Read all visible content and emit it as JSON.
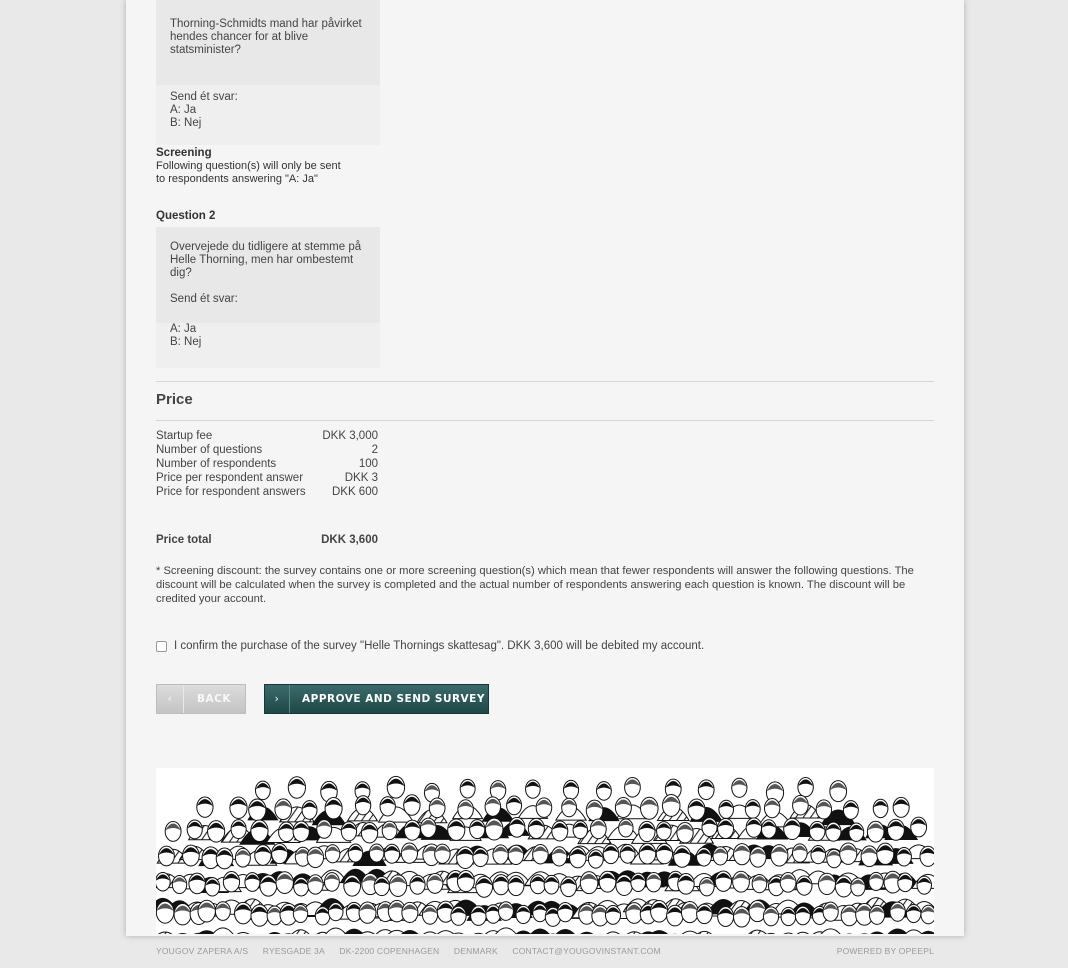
{
  "question1": {
    "text_lines": [
      "Thorning-Schmidts mand har påvirket",
      "hendes chancer for at blive",
      "statsminister?"
    ],
    "send_label": "Send ét svar:",
    "options": [
      "A: Ja",
      "B: Nej"
    ]
  },
  "screening": {
    "title": "Screening",
    "line1": "Following question(s) will only be sent",
    "line2": "to respondents answering \"A: Ja\""
  },
  "question2": {
    "label": "Question 2",
    "text_lines": [
      "Overvejede du tidligere at stemme på",
      "Helle Thorning, men har ombestemt",
      "dig?"
    ],
    "send_label": "Send ét svar:",
    "options": [
      "A: Ja",
      "B: Nej"
    ]
  },
  "price": {
    "title": "Price",
    "rows": [
      {
        "label": "Startup fee",
        "value": "DKK 3,000"
      },
      {
        "label": "Number of questions",
        "value": "2"
      },
      {
        "label": "Number of respondents",
        "value": "100"
      },
      {
        "label": "Price per respondent answer",
        "value": "DKK 3"
      },
      {
        "label": "Price for respondent answers",
        "value": "DKK 600"
      }
    ],
    "total_label": "Price total",
    "total_value": "DKK 3,600"
  },
  "disclaimer": "* Screening discount: the survey contains one or more screening question(s) which mean that fewer respondents will answer the following questions. The discount will be calculated when the survey is completed and the actual number of respondents answering each question is known. The discount will be credited your account.",
  "confirm_label": "I confirm the purchase of the survey \"Helle Thornings skattesag\". DKK 3,600 will be debited my account.",
  "buttons": {
    "back": "BACK",
    "approve": "APPROVE AND SEND SURVEY"
  },
  "footer": {
    "company": "YOUGOV ZAPERA A/S",
    "street": "RYESGADE 3A",
    "city": "DK-2200 COPENHAGEN",
    "country": "DENMARK",
    "email": "CONTACT@YOUGOVINSTANT.COM",
    "powered": "POWERED BY OPEEPL"
  },
  "colors": {
    "approve_button": "#2a5555",
    "back_button": "#cfcfcf",
    "page_background": "#f5f5f5"
  }
}
